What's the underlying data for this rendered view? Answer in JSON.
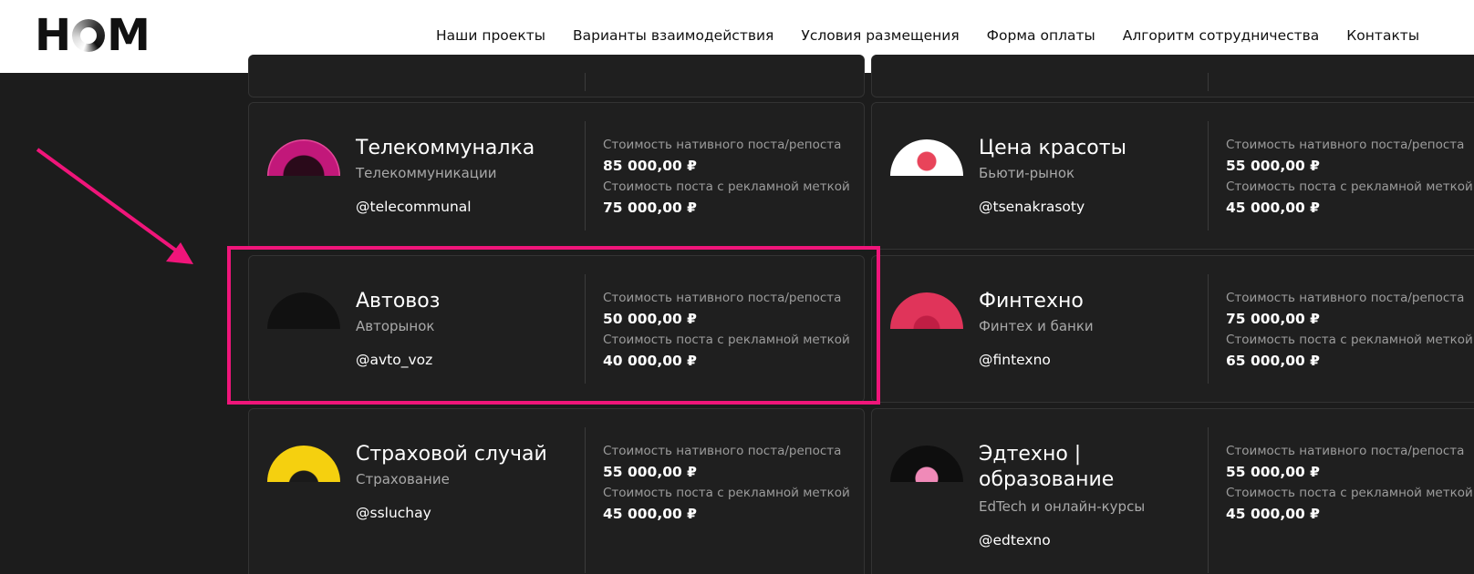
{
  "header": {
    "logo_text": "HOM",
    "nav": [
      "Наши проекты",
      "Варианты взаимодействия",
      "Условия размещения",
      "Форма оплаты",
      "Алгоритм сотрудничества",
      "Контакты"
    ]
  },
  "labels": {
    "native_cost": "Стоимость нативного поста/репоста",
    "ad_cost": "Стоимость поста с рекламной меткой"
  },
  "cards": [
    {
      "name": "Телекоммуналка",
      "category": "Телекоммуникации",
      "handle": "@telecommunal",
      "native": "85 000,00 ₽",
      "ad": "75 000,00 ₽",
      "avatar_color": "#c2187a"
    },
    {
      "name": "Цена красоты",
      "category": "Бьюти-рынок",
      "handle": "@tsenakrasoty",
      "native": "55 000,00 ₽",
      "ad": "45 000,00 ₽",
      "avatar_color": "#ffffff"
    },
    {
      "name": "Автовоз",
      "category": "Авторынок",
      "handle": "@avto_voz",
      "native": "50 000,00 ₽",
      "ad": "40 000,00 ₽",
      "avatar_color": "#111111"
    },
    {
      "name": "Финтехно",
      "category": "Финтех и банки",
      "handle": "@fintexno",
      "native": "75 000,00 ₽",
      "ad": "65 000,00 ₽",
      "avatar_color": "#e0345a"
    },
    {
      "name": "Страховой случай",
      "category": "Страхование",
      "handle": "@ssluchay",
      "native": "55 000,00 ₽",
      "ad": "45 000,00 ₽",
      "avatar_color": "#f5d00f"
    },
    {
      "name": "Эдтехно | образование",
      "category": "EdTech и онлайн-курсы",
      "handle": "@edtexno",
      "native": "55 000,00 ₽",
      "ad": "45 000,00 ₽",
      "avatar_color": "#0e0e0e"
    }
  ],
  "colors": {
    "accent": "#f0157a",
    "background": "#1c1c1c",
    "card": "#1f1f1f"
  }
}
